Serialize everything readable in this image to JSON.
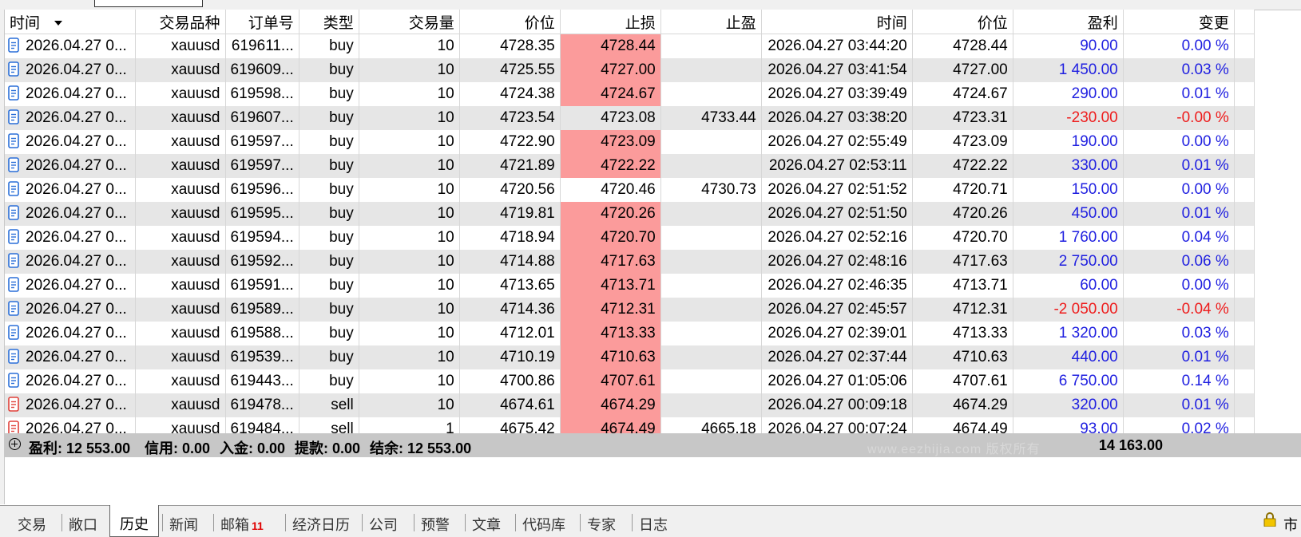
{
  "table": {
    "headers": {
      "open_time": "时间",
      "symbol": "交易品种",
      "ticket": "订单号",
      "type": "类型",
      "volume": "交易量",
      "open_price": "价位",
      "sl": "止损",
      "tp": "止盈",
      "close_time": "时间",
      "close_price": "价位",
      "profit": "盈利",
      "change": "变更"
    },
    "rows": [
      {
        "open_time": "2026.04.27 0...",
        "symbol": "xauusd",
        "ticket": "619611...",
        "type": "buy",
        "volume": "10",
        "open_price": "4728.35",
        "sl": "4728.44",
        "tp": "",
        "close_time": "2026.04.27 03:44:20",
        "close_price": "4728.44",
        "profit": "90.00",
        "change": "0.00 %",
        "icon": "buy-doc-icon",
        "sl_hit": true,
        "negative": false
      },
      {
        "open_time": "2026.04.27 0...",
        "symbol": "xauusd",
        "ticket": "619609...",
        "type": "buy",
        "volume": "10",
        "open_price": "4725.55",
        "sl": "4727.00",
        "tp": "",
        "close_time": "2026.04.27 03:41:54",
        "close_price": "4727.00",
        "profit": "1 450.00",
        "change": "0.03 %",
        "icon": "buy-doc-icon",
        "sl_hit": true,
        "negative": false
      },
      {
        "open_time": "2026.04.27 0...",
        "symbol": "xauusd",
        "ticket": "619598...",
        "type": "buy",
        "volume": "10",
        "open_price": "4724.38",
        "sl": "4724.67",
        "tp": "",
        "close_time": "2026.04.27 03:39:49",
        "close_price": "4724.67",
        "profit": "290.00",
        "change": "0.01 %",
        "icon": "buy-doc-icon",
        "sl_hit": true,
        "negative": false
      },
      {
        "open_time": "2026.04.27 0...",
        "symbol": "xauusd",
        "ticket": "619607...",
        "type": "buy",
        "volume": "10",
        "open_price": "4723.54",
        "sl": "4723.08",
        "tp": "4733.44",
        "close_time": "2026.04.27 03:38:20",
        "close_price": "4723.31",
        "profit": "-230.00",
        "change": "-0.00 %",
        "icon": "buy-doc-icon",
        "sl_hit": false,
        "negative": true
      },
      {
        "open_time": "2026.04.27 0...",
        "symbol": "xauusd",
        "ticket": "619597...",
        "type": "buy",
        "volume": "10",
        "open_price": "4722.90",
        "sl": "4723.09",
        "tp": "",
        "close_time": "2026.04.27 02:55:49",
        "close_price": "4723.09",
        "profit": "190.00",
        "change": "0.00 %",
        "icon": "buy-doc-icon",
        "sl_hit": true,
        "negative": false
      },
      {
        "open_time": "2026.04.27 0...",
        "symbol": "xauusd",
        "ticket": "619597...",
        "type": "buy",
        "volume": "10",
        "open_price": "4721.89",
        "sl": "4722.22",
        "tp": "",
        "close_time": "2026.04.27 02:53:11",
        "close_price": "4722.22",
        "profit": "330.00",
        "change": "0.01 %",
        "icon": "buy-doc-icon",
        "sl_hit": true,
        "negative": false
      },
      {
        "open_time": "2026.04.27 0...",
        "symbol": "xauusd",
        "ticket": "619596...",
        "type": "buy",
        "volume": "10",
        "open_price": "4720.56",
        "sl": "4720.46",
        "tp": "4730.73",
        "close_time": "2026.04.27 02:51:52",
        "close_price": "4720.71",
        "profit": "150.00",
        "change": "0.00 %",
        "icon": "buy-doc-icon",
        "sl_hit": false,
        "negative": false
      },
      {
        "open_time": "2026.04.27 0...",
        "symbol": "xauusd",
        "ticket": "619595...",
        "type": "buy",
        "volume": "10",
        "open_price": "4719.81",
        "sl": "4720.26",
        "tp": "",
        "close_time": "2026.04.27 02:51:50",
        "close_price": "4720.26",
        "profit": "450.00",
        "change": "0.01 %",
        "icon": "buy-doc-icon",
        "sl_hit": true,
        "negative": false
      },
      {
        "open_time": "2026.04.27 0...",
        "symbol": "xauusd",
        "ticket": "619594...",
        "type": "buy",
        "volume": "10",
        "open_price": "4718.94",
        "sl": "4720.70",
        "tp": "",
        "close_time": "2026.04.27 02:52:16",
        "close_price": "4720.70",
        "profit": "1 760.00",
        "change": "0.04 %",
        "icon": "buy-doc-icon",
        "sl_hit": true,
        "negative": false
      },
      {
        "open_time": "2026.04.27 0...",
        "symbol": "xauusd",
        "ticket": "619592...",
        "type": "buy",
        "volume": "10",
        "open_price": "4714.88",
        "sl": "4717.63",
        "tp": "",
        "close_time": "2026.04.27 02:48:16",
        "close_price": "4717.63",
        "profit": "2 750.00",
        "change": "0.06 %",
        "icon": "buy-doc-icon",
        "sl_hit": true,
        "negative": false
      },
      {
        "open_time": "2026.04.27 0...",
        "symbol": "xauusd",
        "ticket": "619591...",
        "type": "buy",
        "volume": "10",
        "open_price": "4713.65",
        "sl": "4713.71",
        "tp": "",
        "close_time": "2026.04.27 02:46:35",
        "close_price": "4713.71",
        "profit": "60.00",
        "change": "0.00 %",
        "icon": "buy-doc-icon",
        "sl_hit": true,
        "negative": false
      },
      {
        "open_time": "2026.04.27 0...",
        "symbol": "xauusd",
        "ticket": "619589...",
        "type": "buy",
        "volume": "10",
        "open_price": "4714.36",
        "sl": "4712.31",
        "tp": "",
        "close_time": "2026.04.27 02:45:57",
        "close_price": "4712.31",
        "profit": "-2 050.00",
        "change": "-0.04 %",
        "icon": "buy-doc-icon",
        "sl_hit": true,
        "negative": true
      },
      {
        "open_time": "2026.04.27 0...",
        "symbol": "xauusd",
        "ticket": "619588...",
        "type": "buy",
        "volume": "10",
        "open_price": "4712.01",
        "sl": "4713.33",
        "tp": "",
        "close_time": "2026.04.27 02:39:01",
        "close_price": "4713.33",
        "profit": "1 320.00",
        "change": "0.03 %",
        "icon": "buy-doc-icon",
        "sl_hit": true,
        "negative": false
      },
      {
        "open_time": "2026.04.27 0...",
        "symbol": "xauusd",
        "ticket": "619539...",
        "type": "buy",
        "volume": "10",
        "open_price": "4710.19",
        "sl": "4710.63",
        "tp": "",
        "close_time": "2026.04.27 02:37:44",
        "close_price": "4710.63",
        "profit": "440.00",
        "change": "0.01 %",
        "icon": "buy-doc-icon",
        "sl_hit": true,
        "negative": false
      },
      {
        "open_time": "2026.04.27 0...",
        "symbol": "xauusd",
        "ticket": "619443...",
        "type": "buy",
        "volume": "10",
        "open_price": "4700.86",
        "sl": "4707.61",
        "tp": "",
        "close_time": "2026.04.27 01:05:06",
        "close_price": "4707.61",
        "profit": "6 750.00",
        "change": "0.14 %",
        "icon": "buy-doc-icon",
        "sl_hit": true,
        "negative": false
      },
      {
        "open_time": "2026.04.27 0...",
        "symbol": "xauusd",
        "ticket": "619478...",
        "type": "sell",
        "volume": "10",
        "open_price": "4674.61",
        "sl": "4674.29",
        "tp": "",
        "close_time": "2026.04.27 00:09:18",
        "close_price": "4674.29",
        "profit": "320.00",
        "change": "0.01 %",
        "icon": "sell-doc-icon",
        "sl_hit": true,
        "negative": false
      },
      {
        "open_time": "2026.04.27 0...",
        "symbol": "xauusd",
        "ticket": "619484...",
        "type": "sell",
        "volume": "1",
        "open_price": "4675.42",
        "sl": "4674.49",
        "tp": "4665.18",
        "close_time": "2026.04.27 00:07:24",
        "close_price": "4674.49",
        "profit": "93.00",
        "change": "0.02 %",
        "icon": "sell-doc-icon",
        "sl_hit": true,
        "negative": false
      }
    ]
  },
  "summary": {
    "profit_label": "盈利:",
    "profit_value": "12 553.00",
    "credit_label": "信用:",
    "credit_value": "0.00",
    "deposit_label": "入金:",
    "deposit_value": "0.00",
    "withdrawal_label": "提款:",
    "withdrawal_value": "0.00",
    "balance_label": "结余:",
    "balance_value": "12 553.00",
    "total_profit": "14 163.00",
    "watermark": "www.eezhijia.com 版权所有"
  },
  "tabs": [
    {
      "label": "交易"
    },
    {
      "label": "敞口"
    },
    {
      "label": "历史",
      "active": true
    },
    {
      "label": "新闻"
    },
    {
      "label": "邮箱",
      "badge": "11"
    },
    {
      "label": "经济日历"
    },
    {
      "label": "公司"
    },
    {
      "label": "预警"
    },
    {
      "label": "文章"
    },
    {
      "label": "代码库"
    },
    {
      "label": "专家"
    },
    {
      "label": "日志"
    }
  ],
  "status": {
    "text": "市"
  },
  "colors": {
    "positive": "#1f1fe0",
    "negative": "#ee1c1c",
    "sl_highlight": "#fb9b9b",
    "row_alt": "#e6e6e6",
    "summary_bg": "#c7c7c7",
    "buy_icon": "#2a6fd8",
    "sell_icon": "#e0413a"
  }
}
